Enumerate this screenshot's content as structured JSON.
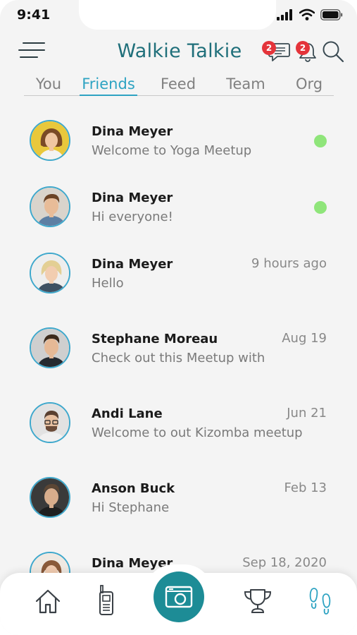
{
  "status": {
    "time": "9:41"
  },
  "header": {
    "title": "Walkie Talkie",
    "chat_badge": "2",
    "bell_badge": "2"
  },
  "tabs": [
    {
      "label": "You"
    },
    {
      "label": "Friends"
    },
    {
      "label": "Feed"
    },
    {
      "label": "Team"
    },
    {
      "label": "Org"
    }
  ],
  "active_tab": "Friends",
  "conversations": [
    {
      "name": "Dina Meyer",
      "message": "Welcome to Yoga Meetup",
      "time": "",
      "online": true,
      "avatar": "woman-yellow-bg-avatar"
    },
    {
      "name": "Dina Meyer",
      "message": "Hi everyone!",
      "time": "",
      "online": true,
      "avatar": "man-brown-hair-avatar"
    },
    {
      "name": "Dina Meyer",
      "message": "Hello",
      "time": "9 hours ago",
      "online": false,
      "avatar": "woman-blonde-avatar"
    },
    {
      "name": "Stephane Moreau",
      "message": "Check out this Meetup with",
      "time": "Aug 19",
      "online": false,
      "avatar": "man-dark-jacket-avatar"
    },
    {
      "name": "Andi Lane",
      "message": "Welcome to out Kizomba meetup",
      "time": "Jun 21",
      "online": false,
      "avatar": "man-glasses-avatar"
    },
    {
      "name": "Anson Buck",
      "message": "Hi Stephane",
      "time": "Feb 13",
      "online": false,
      "avatar": "man-dark-background-avatar"
    },
    {
      "name": "Dina Meyer",
      "message": "",
      "time": "Sep 18, 2020",
      "online": false,
      "avatar": "woman-avatar"
    }
  ],
  "bottom_nav": [
    {
      "icon": "home-icon"
    },
    {
      "icon": "walkie-talkie-icon"
    },
    {
      "icon": "camera-icon"
    },
    {
      "icon": "trophy-icon"
    },
    {
      "icon": "footprints-icon"
    }
  ],
  "colors": {
    "accent": "#2ea3c2",
    "title": "#1f6f7a",
    "fab": "#1d8c96",
    "badge": "#e4343a",
    "online": "#8fe57a"
  }
}
